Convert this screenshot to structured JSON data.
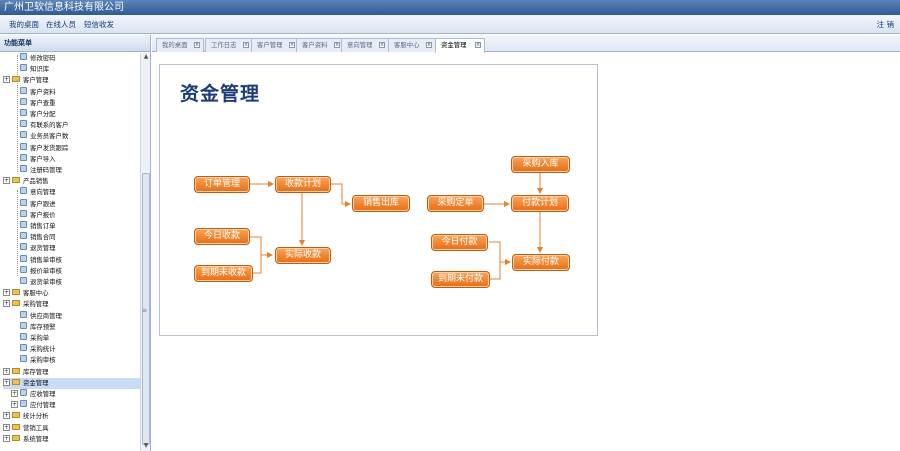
{
  "app": {
    "title": "广州卫软信息科技有限公司"
  },
  "nav": {
    "links": [
      "我的桌面",
      "在线人员",
      "短信收发"
    ],
    "logout": "注 销"
  },
  "sidebar": {
    "header": "功能菜单",
    "items": [
      {
        "label": "修改密码",
        "type": "leaf"
      },
      {
        "label": "知识库",
        "type": "leaf"
      },
      {
        "label": "客户管理",
        "type": "folder"
      },
      {
        "label": "客户资料",
        "type": "leaf"
      },
      {
        "label": "客户查重",
        "type": "leaf"
      },
      {
        "label": "客户分配",
        "type": "leaf"
      },
      {
        "label": "有联系的客户",
        "type": "leaf"
      },
      {
        "label": "业务员客户数",
        "type": "leaf"
      },
      {
        "label": "客户发货跟踪",
        "type": "leaf"
      },
      {
        "label": "客户导入",
        "type": "leaf"
      },
      {
        "label": "注册码管理",
        "type": "leaf"
      },
      {
        "label": "产品销售",
        "type": "folder"
      },
      {
        "label": "意向管理",
        "type": "leaf"
      },
      {
        "label": "客户跟进",
        "type": "leaf"
      },
      {
        "label": "客户报价",
        "type": "leaf"
      },
      {
        "label": "销售订单",
        "type": "leaf"
      },
      {
        "label": "销售合同",
        "type": "leaf"
      },
      {
        "label": "退货管理",
        "type": "leaf"
      },
      {
        "label": "销售单审核",
        "type": "leaf"
      },
      {
        "label": "报价单审核",
        "type": "leaf"
      },
      {
        "label": "退货单审核",
        "type": "leaf"
      },
      {
        "label": "客服中心",
        "type": "folder"
      },
      {
        "label": "采购管理",
        "type": "folder"
      },
      {
        "label": "供应商管理",
        "type": "leaf"
      },
      {
        "label": "库存预警",
        "type": "leaf"
      },
      {
        "label": "采购单",
        "type": "leaf"
      },
      {
        "label": "采购统计",
        "type": "leaf"
      },
      {
        "label": "采购审核",
        "type": "leaf"
      },
      {
        "label": "库存管理",
        "type": "folder"
      },
      {
        "label": "资金管理",
        "type": "folder"
      },
      {
        "label": "应收管理",
        "type": "folder"
      },
      {
        "label": "应付管理",
        "type": "folder"
      },
      {
        "label": "统计分析",
        "type": "folder"
      },
      {
        "label": "营销工具",
        "type": "folder"
      },
      {
        "label": "系统管理",
        "type": "folder"
      }
    ]
  },
  "tabs": [
    "我的桌面",
    "工作日志",
    "客户管理",
    "客户资料",
    "意向管理",
    "客服中心",
    "资金管理"
  ],
  "active_tab": "资金管理",
  "content": {
    "title": "资金管理",
    "nodes": {
      "order_mgmt": "订单管理",
      "collection_plan": "收款计划",
      "sales_out": "销售出库",
      "today_receipt": "今日收款",
      "due_unreceived": "到期未收款",
      "actual_receipt": "实际收款",
      "purchase_in": "采购入库",
      "purchase_order": "采购定单",
      "payment_plan": "付款计划",
      "today_payment": "今日付款",
      "due_unpaid": "到期未付款",
      "actual_payment": "实际付款"
    }
  },
  "colors": {
    "node_fill": "#e86c12",
    "node_border": "#c45a0a",
    "title": "#1b3b7a",
    "header": "#2e5a94"
  }
}
